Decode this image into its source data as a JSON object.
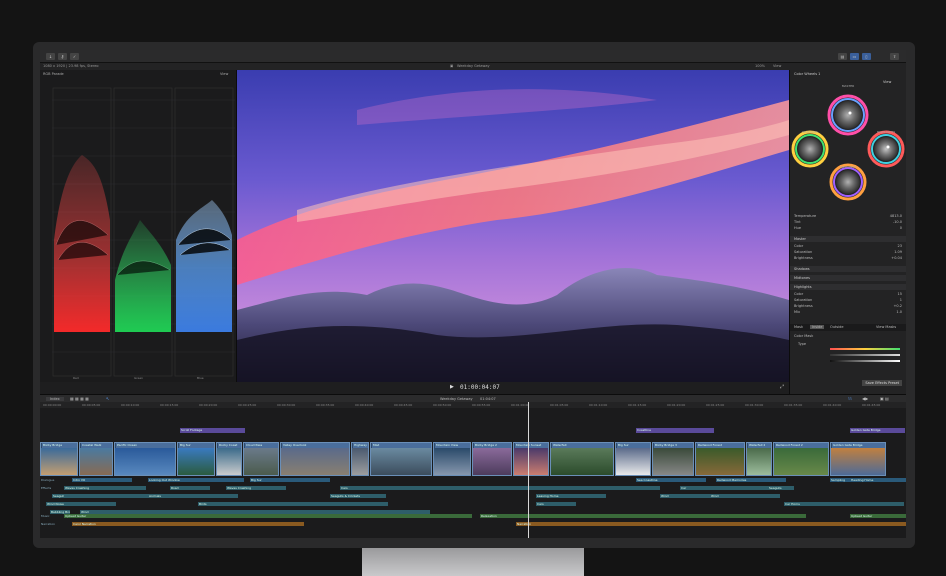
{
  "infobar": {
    "format": "1080 x 1920 | 23.98 fps, Stereo",
    "library": "Weekday Getaway",
    "zoom": "100%",
    "view": "View",
    "timecode": "01:00:04:07"
  },
  "scopes": {
    "title": "RGB Parade",
    "view": "View",
    "channels": [
      "Red",
      "Green",
      "Blue"
    ]
  },
  "inspector": {
    "effect": "Color Wheels 1",
    "view": "View",
    "wheels": [
      "MASTER",
      "SHADOWS",
      "HIGHLIGHTS",
      "MIDTONES"
    ],
    "temperature": {
      "label": "Temperature",
      "value": "4813.0"
    },
    "tint": {
      "label": "Tint",
      "value": "-10.0"
    },
    "hue": {
      "label": "Hue",
      "value": "0"
    },
    "sections": {
      "master": "Master",
      "shadows": "Shadows",
      "midtones": "Midtones",
      "highlights": "Highlights"
    },
    "master_rows": [
      {
        "label": "Color",
        "value": "23"
      },
      {
        "label": "Saturation",
        "value": "1.09"
      },
      {
        "label": "Brightness",
        "value": "+0.04"
      }
    ],
    "highlight_rows": [
      {
        "label": "Color",
        "value": "15"
      },
      {
        "label": "Saturation",
        "value": "1"
      },
      {
        "label": "Brightness",
        "value": "+0.2"
      },
      {
        "label": "Mix",
        "value": "1.0"
      }
    ],
    "tabs": [
      "Mask",
      "Inside",
      "Outside"
    ],
    "view_masks": "View Masks",
    "color_mask": "Color Mask",
    "type_label": "Type",
    "save_preset": "Save Effects Preset"
  },
  "timeline": {
    "index": "Index",
    "project": "Weekday Getaway",
    "project_duration": "01:04:07",
    "ruler": [
      "00:00:00:00",
      "00:00:05:00",
      "00:00:10:00",
      "00:00:15:00",
      "00:00:20:00",
      "00:00:25:00",
      "00:00:30:00",
      "00:00:35:00",
      "00:00:40:00",
      "00:00:45:00",
      "00:00:50:00",
      "00:00:55:00",
      "00:01:00:00",
      "00:01:05:00",
      "00:01:10:00",
      "00:01:15:00",
      "00:01:20:00",
      "00:01:25:00",
      "00:01:30:00",
      "00:01:35:00",
      "00:01:40:00",
      "00:01:45:00"
    ],
    "titles": [
      "Scroll Footage",
      "Coastline",
      "Golden Gate Bridge"
    ],
    "video_clips": [
      "Bixby Bridge",
      "Coastal Walk",
      "Pacific Ocean",
      "Big Sur",
      "Rocky Coast",
      "Cloud Pass",
      "Valley Overlook",
      "Highway 1 Sunset",
      "Mist",
      "Mountain View",
      "Bixby Bridge 2",
      "Mountain Sunset",
      "Waterfall",
      "Big Sur",
      "Bixby Bridge 3",
      "Redwood Forest",
      "Waterfall 2",
      "Redwood Forest 2",
      "Golden Gate Bridge"
    ],
    "dialogue": [
      "Dialogue",
      "Intro VO",
      "Looking Out Window",
      "Big Sur",
      "Sea Coastline",
      "Redwood Memories",
      "Sampling",
      "Heading Home"
    ],
    "effects": [
      "Effects",
      "Waves Crashing",
      "Road",
      "Waves Crashing",
      "Cars",
      "Seagull",
      "Animals",
      "Seagulls & Crickets",
      "Car",
      "Seagulls",
      "Leaving Home",
      "Wind",
      "Wind",
      "Wind Noise",
      "Birds",
      "Babbling Brook",
      "Cars",
      "Car Horns",
      "Wind"
    ],
    "music": [
      "Music",
      "Upbeat Guitar",
      "Relaxation",
      "Upbeat Guitar"
    ],
    "narration": [
      "Narration",
      "Carol Narration",
      "Narration"
    ]
  }
}
